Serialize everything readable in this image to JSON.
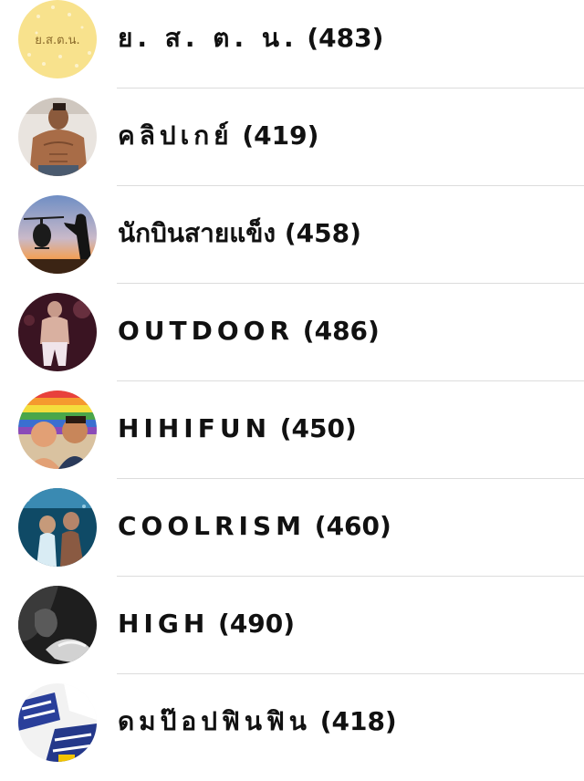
{
  "groups": [
    {
      "name": "ย. ส. ต. น.",
      "count": "(483)",
      "avatar": "yasatana-logo-avatar",
      "logo_text": "ย.ส.ต.น."
    },
    {
      "name": "คลิปเกย์",
      "count": "(419)",
      "avatar": "muscle-man-avatar"
    },
    {
      "name": "นักบินสายแข็ง",
      "count": "(458)",
      "avatar": "helicopter-pilot-avatar"
    },
    {
      "name": "OUTDOOR",
      "count": "(486)",
      "avatar": "outdoor-night-avatar"
    },
    {
      "name": "HIHIFUN",
      "count": "(450)",
      "avatar": "cartoon-rainbow-avatar"
    },
    {
      "name": "COOLRISM",
      "count": "(460)",
      "avatar": "underwater-couple-avatar"
    },
    {
      "name": "HIGH",
      "count": "(490)",
      "avatar": "smoke-bw-avatar"
    },
    {
      "name": "ดมป๊อปฟินฟิน",
      "count": "(418)",
      "avatar": "underwear-avatar"
    }
  ],
  "colors": {
    "text": "#111111",
    "separator": "#dcdcdc",
    "logo_bg": "#f8e28d",
    "logo_text": "#8a6a2a"
  }
}
